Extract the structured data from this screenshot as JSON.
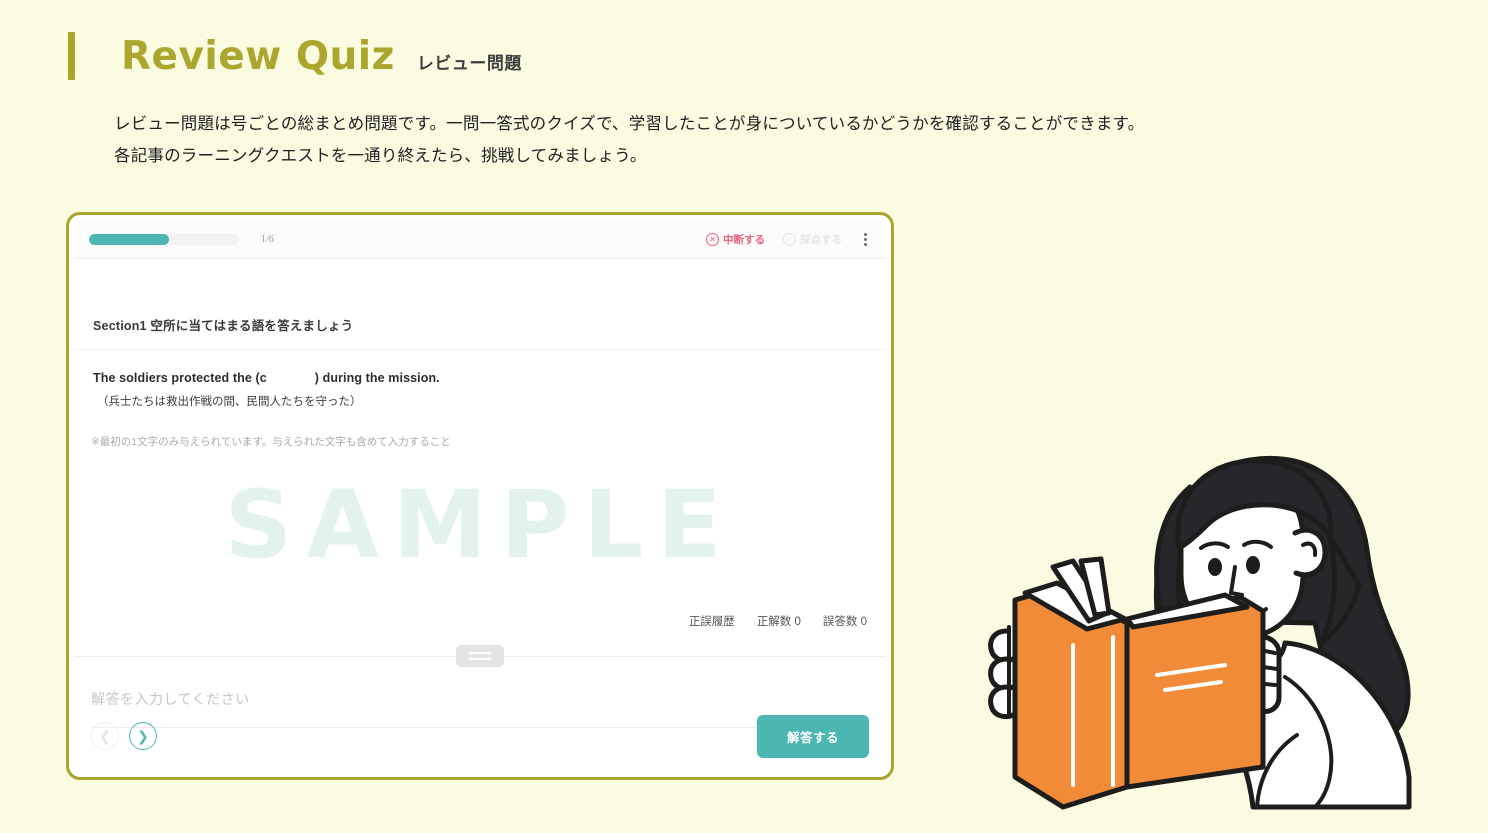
{
  "page": {
    "background_color": "#fafbe0",
    "accent_color": "#a8a52a",
    "brand_teal": "#4cb7b2",
    "title": "Review Quiz",
    "subtitle": "レビュー問題",
    "intro_line1": "レビュー問題は号ごとの総まとめ問題です。一問一答式のクイズで、学習したことが身についているかどうかを確認することができます。",
    "intro_line2": "各記事のラーニングクエストを一通り終えたら、挑戦してみましょう。"
  },
  "quiz": {
    "topbar": {
      "progress_label": "1/6",
      "progress_percent": 53,
      "abort_label": "中断する",
      "abort_icon": "circle-x-icon",
      "abort_color": "#ef5f7e",
      "grade_label": "採点する",
      "grade_icon": "circle-check-icon",
      "menu_icon": "kebab-menu-icon"
    },
    "section_title": "Section1 空所に当てはまる語を答えましょう",
    "question_en_before": "The soldiers protected the (c",
    "question_en_after": ") during the mission.",
    "question_ja": "（兵士たちは救出作戦の間、民間人たちを守った）",
    "question_note": "※最初の1文字のみ与えられています。与えられた文字も含めて入力すること",
    "watermark": "SAMPLE",
    "stats": [
      "正誤履歴",
      "正解数 0",
      "誤答数 0"
    ],
    "answer_placeholder": "解答を入力してください",
    "footer": {
      "prev_icon": "chevron-left-icon",
      "next_icon": "chevron-right-icon",
      "submit_label": "解答する"
    }
  },
  "illustration": {
    "name": "woman-reading-book",
    "book_color": "#f28b37",
    "line_color": "#1d1d1b"
  }
}
